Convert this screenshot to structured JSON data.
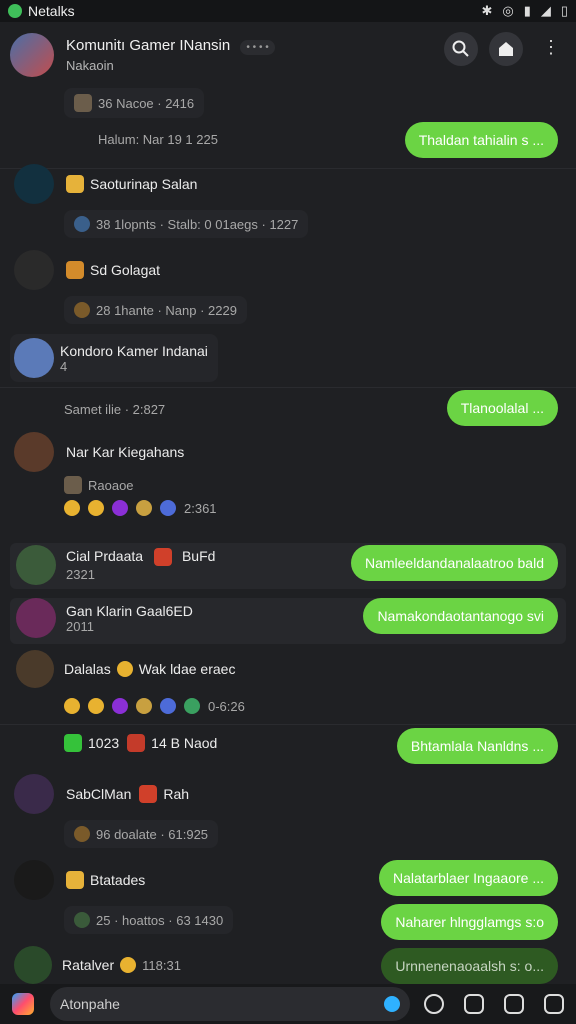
{
  "status": {
    "app": "Netalks"
  },
  "header": {
    "name": "Komunitı Gamer INansin",
    "status": "Nakaoin",
    "search_icon": "search-icon",
    "room_icon": "home-icon",
    "more_icon": "more-vert-icon"
  },
  "messages": [
    {
      "meta": "36 Nacoe · 2416"
    },
    {
      "meta": "Halum: Nar 19 1 225",
      "bubble": "Thaldan tahialin s ..."
    },
    {
      "name": "Saoturinap Salan",
      "meta": "38 1lopnts · Stalb: 0 01aegs · 1227"
    },
    {
      "name": "Sd Golagat",
      "meta": "28 1hante · Nanp · 2229"
    },
    {
      "name": "Kondoro Kamer Indanai",
      "meta2": "4"
    },
    {
      "meta": "Samet ilie · 2:827",
      "bubble": "Tlanoolalal ..."
    },
    {
      "name": "Nar Kar Kiegahans",
      "meta": "Raoaoe",
      "time": "2:361"
    },
    {
      "name": "Cial Prdaata",
      "meta": "2321",
      "sub": "BuFd",
      "bubble": "Namleeldandanalaatroo bald"
    },
    {
      "name": "Gan Klarin Gaal6ED",
      "meta": "2011",
      "bubble": "Namakondaotantanogo svi"
    },
    {
      "name": "Dalalas",
      "sub": "Wak ldae eraec",
      "time": "0-6:26"
    },
    {
      "name": "1023",
      "sub": "14 B Naod",
      "bubble": "Bhtamlala Nanldns ..."
    },
    {
      "name": "SabClMan",
      "sub": "Rah",
      "meta": "96 doalate · 61:925"
    },
    {
      "name": "Btatades",
      "meta": "25 · hoattos · 63 1430",
      "bubble": "Nalatarblaer Ingaaore ...",
      "bubble2": "Naharer hlngglamgs s:o"
    },
    {
      "name": "Ratalver",
      "time": "118:31",
      "bubble": "Urnnenenaoaalsh s: o..."
    }
  ],
  "composer": {
    "placeholder": "Atonpahe"
  }
}
